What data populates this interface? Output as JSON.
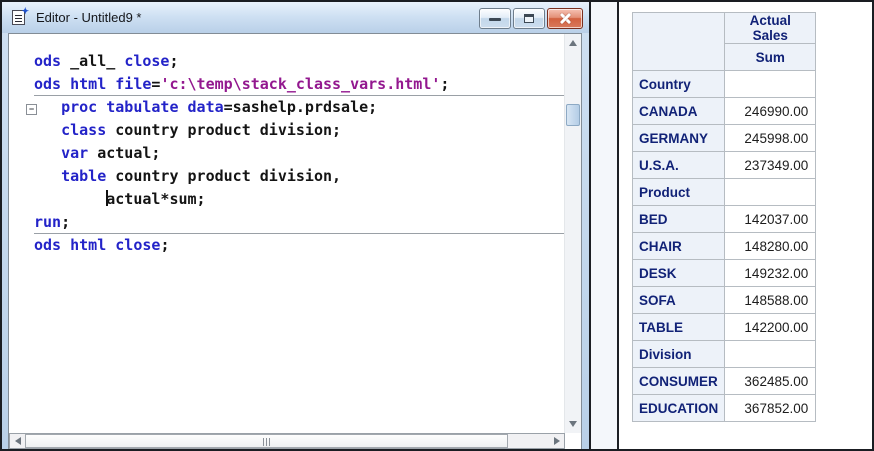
{
  "colors": {
    "keyword_blue": "#2323c8",
    "string_purple": "#93188f",
    "plain_black": "#141414",
    "table_header_text": "#112277",
    "table_header_bg": "#edf2f9",
    "table_border": "#b6bcc2"
  },
  "window": {
    "title": "Editor - Untitled9 *"
  },
  "editor": {
    "lines": [
      {
        "tokens": [
          {
            "c": "kw",
            "t": "ods"
          },
          {
            "c": "pl",
            "t": " _all_ "
          },
          {
            "c": "kw",
            "t": "close"
          },
          {
            "c": "pl",
            "t": ";"
          }
        ]
      },
      {
        "divider": true,
        "tokens": [
          {
            "c": "kw",
            "t": "ods html file"
          },
          {
            "c": "pl",
            "t": "="
          },
          {
            "c": "str",
            "t": "'c:\\temp\\stack_class_vars.html'"
          },
          {
            "c": "pl",
            "t": ";"
          }
        ]
      },
      {
        "fold": true,
        "tokens": [
          {
            "c": "pl",
            "t": "   "
          },
          {
            "c": "kw",
            "t": "proc tabulate"
          },
          {
            "c": "pl",
            "t": " "
          },
          {
            "c": "kw",
            "t": "data"
          },
          {
            "c": "pl",
            "t": "=sashelp.prdsale;"
          }
        ]
      },
      {
        "tokens": [
          {
            "c": "pl",
            "t": "   "
          },
          {
            "c": "kw",
            "t": "class"
          },
          {
            "c": "pl",
            "t": " country product division;"
          }
        ]
      },
      {
        "tokens": [
          {
            "c": "pl",
            "t": "   "
          },
          {
            "c": "kw",
            "t": "var"
          },
          {
            "c": "pl",
            "t": " actual;"
          }
        ]
      },
      {
        "tokens": [
          {
            "c": "pl",
            "t": "   "
          },
          {
            "c": "kw",
            "t": "table"
          },
          {
            "c": "pl",
            "t": " country product division,"
          }
        ]
      },
      {
        "tokens": [
          {
            "c": "pl",
            "t": "        "
          },
          {
            "c": "caret"
          },
          {
            "c": "pl",
            "t": "actual*sum;"
          }
        ]
      },
      {
        "divider": true,
        "tokens": [
          {
            "c": "kw",
            "t": "run"
          },
          {
            "c": "pl",
            "t": ";"
          }
        ]
      },
      {
        "tokens": [
          {
            "c": "kw",
            "t": "ods html close"
          },
          {
            "c": "pl",
            "t": ";"
          }
        ]
      }
    ],
    "fold_glyph": "−"
  },
  "results_table": {
    "column_header": "Actual Sales",
    "statistic_header": "Sum",
    "rows": [
      {
        "label": "Country",
        "value": ""
      },
      {
        "label": "CANADA",
        "value": "246990.00"
      },
      {
        "label": "GERMANY",
        "value": "245998.00"
      },
      {
        "label": "U.S.A.",
        "value": "237349.00"
      },
      {
        "label": "Product",
        "value": ""
      },
      {
        "label": "BED",
        "value": "142037.00"
      },
      {
        "label": "CHAIR",
        "value": "148280.00"
      },
      {
        "label": "DESK",
        "value": "149232.00"
      },
      {
        "label": "SOFA",
        "value": "148588.00"
      },
      {
        "label": "TABLE",
        "value": "142200.00"
      },
      {
        "label": "Division",
        "value": ""
      },
      {
        "label": "CONSUMER",
        "value": "362485.00"
      },
      {
        "label": "EDUCATION",
        "value": "367852.00"
      }
    ]
  }
}
